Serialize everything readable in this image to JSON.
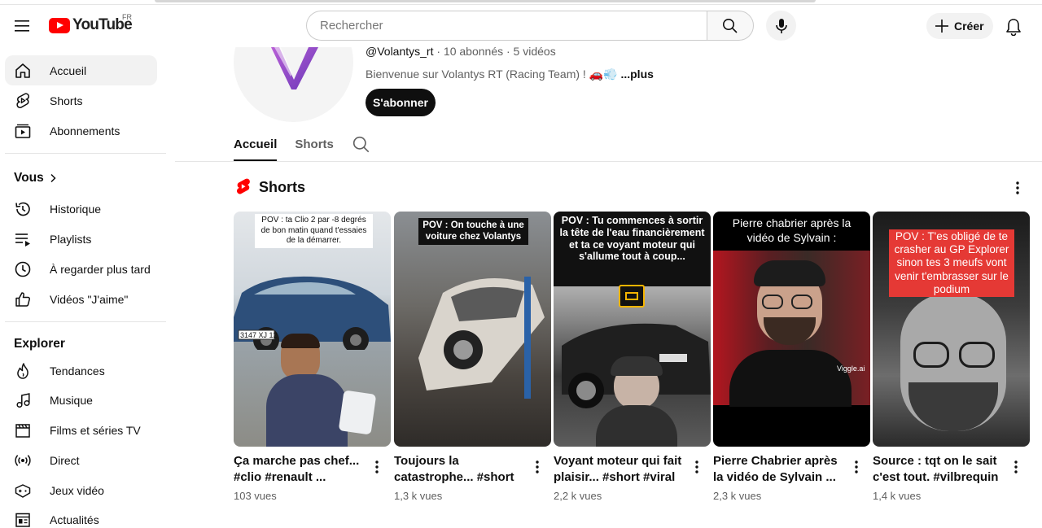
{
  "masthead": {
    "logo_text": "YouTube",
    "country_code": "FR",
    "search_placeholder": "Rechercher",
    "create_label": "Créer"
  },
  "sidebar": {
    "main": [
      {
        "label": "Accueil",
        "icon": "home-icon",
        "active": true
      },
      {
        "label": "Shorts",
        "icon": "shorts-icon"
      },
      {
        "label": "Abonnements",
        "icon": "subscriptions-icon"
      }
    ],
    "you_title": "Vous",
    "you": [
      {
        "label": "Historique",
        "icon": "history-icon"
      },
      {
        "label": "Playlists",
        "icon": "playlists-icon"
      },
      {
        "label": "À regarder plus tard",
        "icon": "watch-later-icon"
      },
      {
        "label": "Vidéos \"J'aime\"",
        "icon": "like-icon"
      }
    ],
    "explore_title": "Explorer",
    "explore": [
      {
        "label": "Tendances",
        "icon": "trending-icon"
      },
      {
        "label": "Musique",
        "icon": "music-icon"
      },
      {
        "label": "Films et séries TV",
        "icon": "movies-icon"
      },
      {
        "label": "Direct",
        "icon": "live-icon"
      },
      {
        "label": "Jeux vidéo",
        "icon": "gaming-icon"
      },
      {
        "label": "Actualités",
        "icon": "news-icon"
      }
    ]
  },
  "channel": {
    "handle": "@Volantys_rt",
    "stats": " · 10 abonnés · 5 vidéos",
    "description": "Bienvenue sur Volantys RT (Racing Team) ! 🚗💨 ",
    "more": "...plus",
    "subscribe_label": "S'abonner",
    "tabs": [
      "Accueil",
      "Shorts"
    ]
  },
  "shelf": {
    "title": "Shorts",
    "items": [
      {
        "title": "Ça marche pas chef... #clio #renault ...",
        "views": "103 vues",
        "overlay": "POV : ta Clio 2 par -8 degrés de bon matin quand t'essaies de la démarrer."
      },
      {
        "title": "Toujours la catastrophe... #short ...",
        "views": "1,3 k vues",
        "overlay": "POV : On touche à une voiture chez Volantys"
      },
      {
        "title": "Voyant moteur qui fait plaisir... #short #viral ...",
        "views": "2,2 k vues",
        "overlay": "POV : Tu commences à sortir la tête de l'eau financièrement et ta ce voyant moteur qui s'allume tout à coup..."
      },
      {
        "title": "Pierre Chabrier après la vidéo de Sylvain ...",
        "views": "2,3 k vues",
        "overlay": "Pierre chabrier après la vidéo de Sylvain :",
        "watermark": "Viggle.ai"
      },
      {
        "title": "Source : tqt on le sait c'est tout. #vilbrequin ...",
        "views": "1,4 k vues",
        "overlay": "POV : T'es obligé de te crasher au GP Explorer sinon tes 3 meufs vont venir t'embrasser sur le podium"
      }
    ]
  },
  "colors": {
    "brand_red": "#ff0000",
    "text": "#0f0f0f",
    "muted": "#606060"
  }
}
